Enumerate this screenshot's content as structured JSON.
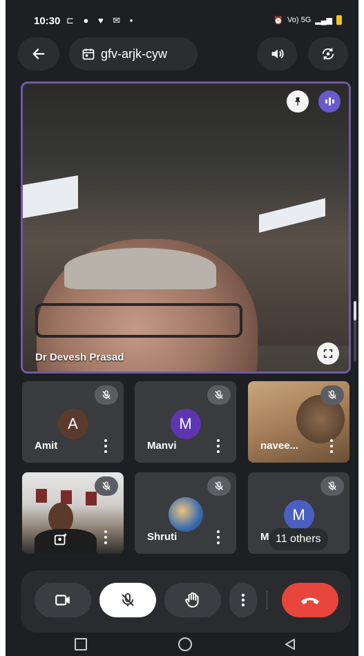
{
  "status_bar": {
    "time": "10:30",
    "right_text": "Vo) 5G"
  },
  "top_bar": {
    "meeting_code": "gfv-arjk-cyw"
  },
  "main_video": {
    "participant_name": "Dr Devesh Prasad"
  },
  "participants": [
    {
      "name": "Amit",
      "initial": "A",
      "avatar_color": "#5b3a2e"
    },
    {
      "name": "Manvi",
      "initial": "M",
      "avatar_color": "#5e35b1"
    },
    {
      "name": "navee...",
      "initial": "",
      "avatar_color": ""
    },
    {
      "name": "",
      "initial": "",
      "avatar_color": ""
    },
    {
      "name": "Shruti",
      "initial": "",
      "avatar_color": ""
    },
    {
      "name": "Ma",
      "initial": "M",
      "avatar_color": "#4a5fc1"
    }
  ],
  "others_chip": "11 others",
  "colors": {
    "end_call": "#e8453c",
    "active_speaker_border": "#6d5ba3",
    "background": "#1e1f22"
  }
}
